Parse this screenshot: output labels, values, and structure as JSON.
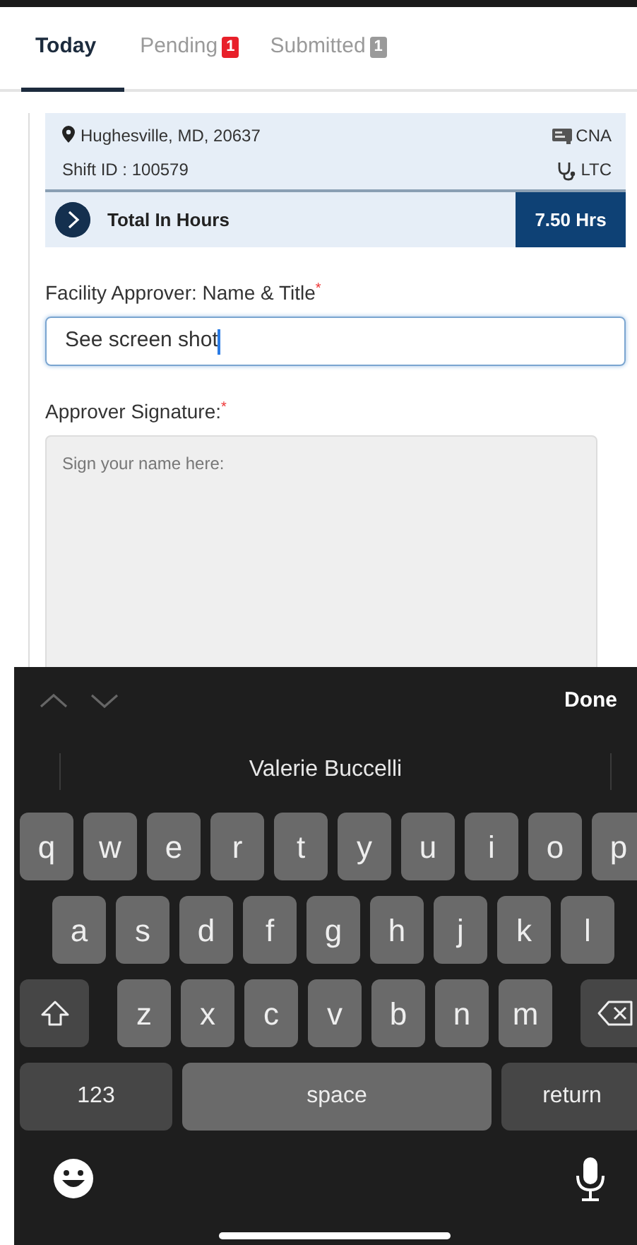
{
  "tabs": [
    {
      "label": "Today",
      "selected": true
    },
    {
      "label": "Pending",
      "selected": false,
      "badge": "1",
      "color": "#e8202a"
    },
    {
      "label": "Submitted",
      "selected": false,
      "badge": "1",
      "color": "#9a9a9a"
    }
  ],
  "shift": {
    "location": "Hughesville, MD, 20637",
    "shift_id": "Shift ID : 100579",
    "role": "CNA",
    "setting": "LTC"
  },
  "total": {
    "label": "Total In Hours",
    "value": "7.50 Hrs"
  },
  "form": [
    {
      "kind": "text",
      "label": "Facility Approver: Name & Title",
      "required_mark": "*",
      "value": "See screen shot",
      "focused": true
    },
    {
      "kind": "signature",
      "label": "Approver Signature:",
      "required_mark": "*",
      "placeholder": "Sign your name here:"
    }
  ],
  "keyboard": {
    "done": "Done",
    "suggestion": "Valerie Buccelli",
    "rows": [
      [
        {
          "kind": "letter",
          "label": "q"
        },
        {
          "kind": "letter",
          "label": "w"
        },
        {
          "kind": "letter",
          "label": "e"
        },
        {
          "kind": "letter",
          "label": "r"
        },
        {
          "kind": "letter",
          "label": "t"
        },
        {
          "kind": "letter",
          "label": "y"
        },
        {
          "kind": "letter",
          "label": "u"
        },
        {
          "kind": "letter",
          "label": "i"
        },
        {
          "kind": "letter",
          "label": "o"
        },
        {
          "kind": "letter",
          "label": "p"
        }
      ],
      [
        {
          "kind": "letter",
          "label": "a"
        },
        {
          "kind": "letter",
          "label": "s"
        },
        {
          "kind": "letter",
          "label": "d"
        },
        {
          "kind": "letter",
          "label": "f"
        },
        {
          "kind": "letter",
          "label": "g"
        },
        {
          "kind": "letter",
          "label": "h"
        },
        {
          "kind": "letter",
          "label": "j"
        },
        {
          "kind": "letter",
          "label": "k"
        },
        {
          "kind": "letter",
          "label": "l"
        }
      ],
      [
        {
          "kind": "shift"
        },
        {
          "kind": "letter",
          "label": "z"
        },
        {
          "kind": "letter",
          "label": "x"
        },
        {
          "kind": "letter",
          "label": "c"
        },
        {
          "kind": "letter",
          "label": "v"
        },
        {
          "kind": "letter",
          "label": "b"
        },
        {
          "kind": "letter",
          "label": "n"
        },
        {
          "kind": "letter",
          "label": "m"
        },
        {
          "kind": "delete"
        }
      ]
    ],
    "bottom_row": [
      {
        "kind": "numbers",
        "label": "123"
      },
      {
        "kind": "space",
        "label": "space"
      },
      {
        "kind": "return",
        "label": "return"
      }
    ]
  }
}
